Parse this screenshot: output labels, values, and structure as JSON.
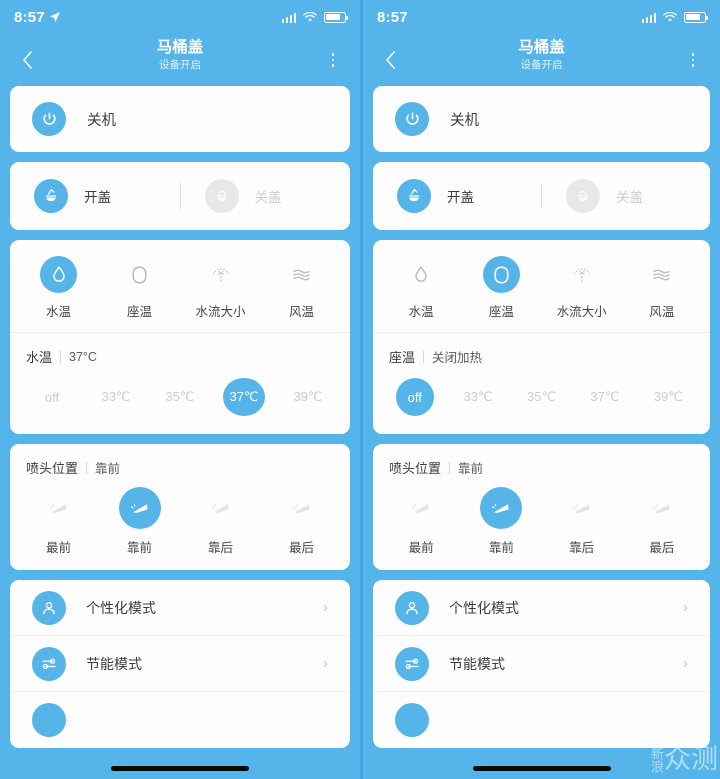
{
  "accent": "#55b5e8",
  "background": "#55b5ea",
  "panels": [
    {
      "status": {
        "time": "8:57",
        "has_location_arrow": true
      },
      "nav": {
        "title": "马桶盖",
        "subtitle": "设备开启"
      },
      "power": {
        "label": "关机",
        "icon": "power-icon"
      },
      "lid": {
        "open_label": "开盖",
        "open_icon": "lid-open-icon",
        "open_active": true,
        "close_label": "关盖",
        "close_icon": "lid-close-icon",
        "close_active": false
      },
      "tabs": [
        {
          "label": "水温",
          "icon": "water-drop-icon",
          "active": true
        },
        {
          "label": "座温",
          "icon": "seat-icon",
          "active": false
        },
        {
          "label": "水流大小",
          "icon": "water-flow-icon",
          "active": false
        },
        {
          "label": "风温",
          "icon": "wind-icon",
          "active": false
        }
      ],
      "value_header": {
        "key": "水温",
        "value": "37°C"
      },
      "steps": [
        {
          "label": "off",
          "selected": false
        },
        {
          "label": "33℃",
          "selected": false
        },
        {
          "label": "35℃",
          "selected": false
        },
        {
          "label": "37℃",
          "selected": true
        },
        {
          "label": "39℃",
          "selected": false
        }
      ],
      "nozzle_header": {
        "key": "喷头位置",
        "value": "靠前"
      },
      "nozzles": [
        {
          "label": "最前",
          "active": false
        },
        {
          "label": "靠前",
          "active": true
        },
        {
          "label": "靠后",
          "active": false
        },
        {
          "label": "最后",
          "active": false
        }
      ],
      "list": [
        {
          "label": "个性化模式",
          "icon": "person-icon",
          "chevron": "›"
        },
        {
          "label": "节能模式",
          "icon": "sliders-icon",
          "chevron": "›"
        }
      ]
    },
    {
      "status": {
        "time": "8:57",
        "has_location_arrow": false
      },
      "nav": {
        "title": "马桶盖",
        "subtitle": "设备开启"
      },
      "power": {
        "label": "关机",
        "icon": "power-icon"
      },
      "lid": {
        "open_label": "开盖",
        "open_icon": "lid-open-icon",
        "open_active": true,
        "close_label": "关盖",
        "close_icon": "lid-close-icon",
        "close_active": false
      },
      "tabs": [
        {
          "label": "水温",
          "icon": "water-drop-icon",
          "active": false
        },
        {
          "label": "座温",
          "icon": "seat-icon",
          "active": true
        },
        {
          "label": "水流大小",
          "icon": "water-flow-icon",
          "active": false
        },
        {
          "label": "风温",
          "icon": "wind-icon",
          "active": false
        }
      ],
      "value_header": {
        "key": "座温",
        "value": "关闭加热"
      },
      "steps": [
        {
          "label": "off",
          "selected": true
        },
        {
          "label": "33℃",
          "selected": false
        },
        {
          "label": "35℃",
          "selected": false
        },
        {
          "label": "37℃",
          "selected": false
        },
        {
          "label": "39℃",
          "selected": false
        }
      ],
      "nozzle_header": {
        "key": "喷头位置",
        "value": "靠前"
      },
      "nozzles": [
        {
          "label": "最前",
          "active": false
        },
        {
          "label": "靠前",
          "active": true
        },
        {
          "label": "靠后",
          "active": false
        },
        {
          "label": "最后",
          "active": false
        }
      ],
      "list": [
        {
          "label": "个性化模式",
          "icon": "person-icon",
          "chevron": "›"
        },
        {
          "label": "节能模式",
          "icon": "sliders-icon",
          "chevron": "›"
        }
      ]
    }
  ],
  "watermark": {
    "small": "新浪",
    "big": "众测"
  }
}
